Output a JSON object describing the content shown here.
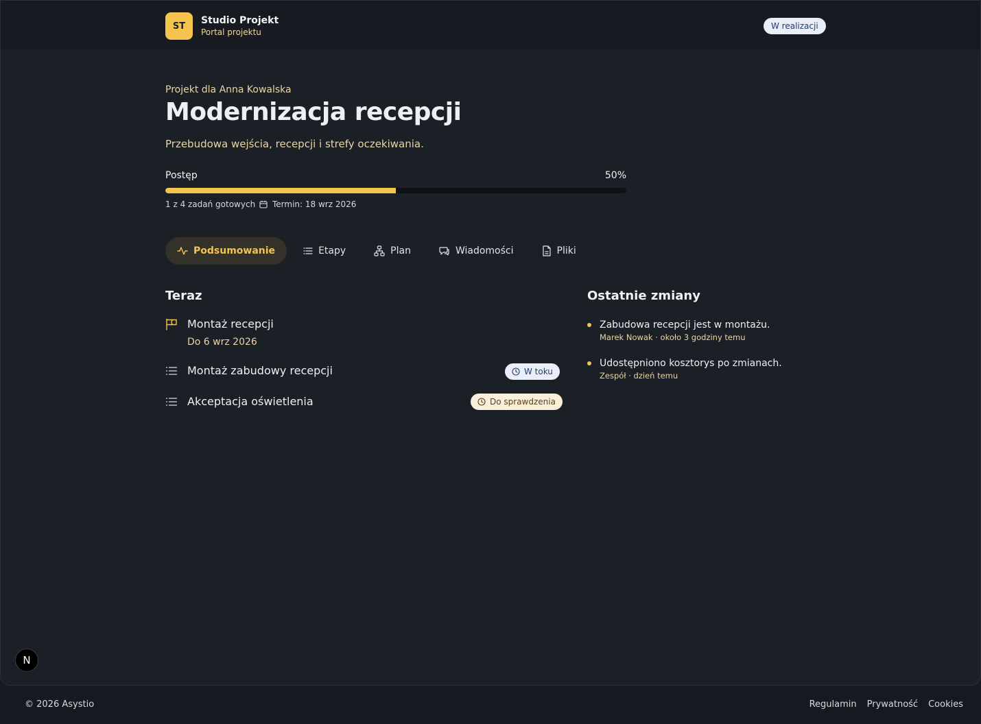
{
  "header": {
    "logo_initials": "ST",
    "brand_name": "Studio Projekt",
    "brand_subtitle": "Portal projektu",
    "status": "W realizacji"
  },
  "project": {
    "client_line": "Projekt dla Anna Kowalska",
    "title": "Modernizacja recepcji",
    "description": "Przebudowa wejścia, recepcji i strefy oczekiwania."
  },
  "progress": {
    "label": "Postęp",
    "percent_label": "50%",
    "percent": 50,
    "tasks_done": "1 z 4 zadań gotowych",
    "deadline": "Termin: 18 wrz 2026"
  },
  "tabs": [
    {
      "label": "Podsumowanie",
      "icon": "activity-icon",
      "active": true
    },
    {
      "label": "Etapy",
      "icon": "list-icon",
      "active": false
    },
    {
      "label": "Plan",
      "icon": "sitemap-icon",
      "active": false
    },
    {
      "label": "Wiadomości",
      "icon": "chat-icon",
      "active": false
    },
    {
      "label": "Pliki",
      "icon": "file-icon",
      "active": false
    }
  ],
  "now": {
    "title": "Teraz",
    "milestone": {
      "label": "Montaż recepcji",
      "due": "Do 6 wrz 2026",
      "icon": "flag-icon"
    },
    "tasks": [
      {
        "label": "Montaż zabudowy recepcji",
        "status": "W toku",
        "status_color": "#e9eef8"
      },
      {
        "label": "Akceptacja oświetlenia",
        "status": "Do sprawdzenia",
        "status_color": "#f9efdb"
      }
    ]
  },
  "changes": {
    "title": "Ostatnie zmiany",
    "items": [
      {
        "text": "Zabudowa recepcji jest w montażu.",
        "meta": "Marek Nowak · około 3 godziny temu"
      },
      {
        "text": "Udostępniono kosztorys po zmianach.",
        "meta": "Zespół · dzień temu"
      }
    ]
  },
  "dev_badge": "N",
  "footer": {
    "copyright": "© 2026 Asystio",
    "links": [
      "Regulamin",
      "Prywatność",
      "Cookies"
    ]
  },
  "colors": {
    "accent": "#f5c44e",
    "background": "#1b1f26"
  }
}
